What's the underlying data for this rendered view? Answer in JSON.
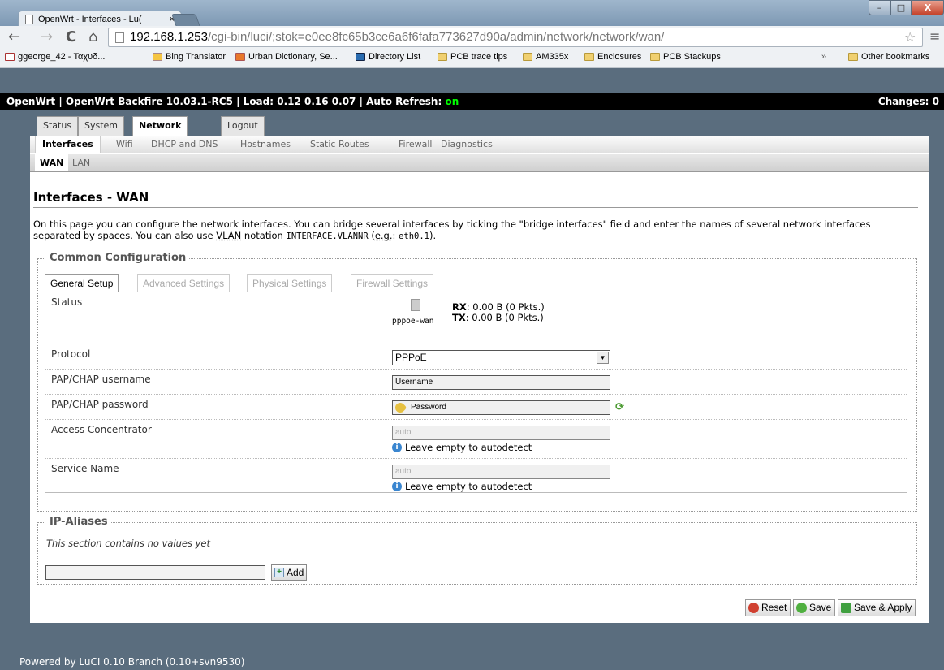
{
  "browser": {
    "tab_title": "OpenWrt - Interfaces - Lu(",
    "tab_close": "×",
    "url_host": "192.168.1.253",
    "url_path": "/cgi-bin/luci/;stok=e0ee8fc65b3ce6a6f6fafa773627d90a/admin/network/network/wan/",
    "back": "←",
    "forward": "→",
    "reload": "C",
    "home": "⌂",
    "star": "☆",
    "menu": "≡",
    "window_min": "–",
    "window_max": "□",
    "window_close": "X",
    "bookmarks": [
      {
        "label": "ggeorge_42 - Ταχυδ...",
        "icon": "mail-icon"
      },
      {
        "label": "Bing Translator",
        "icon": "bing-icon"
      },
      {
        "label": "Urban Dictionary, Se...",
        "icon": "ud-icon"
      },
      {
        "label": "Directory List",
        "icon": "directory-icon"
      },
      {
        "label": "PCB trace tips",
        "icon": "folder-icon"
      },
      {
        "label": "AM335x",
        "icon": "folder-icon"
      },
      {
        "label": "Enclosures",
        "icon": "folder-icon"
      },
      {
        "label": "PCB Stackups",
        "icon": "folder-icon"
      }
    ],
    "bookmarks_overflow": "»",
    "other_bookmarks": "Other bookmarks"
  },
  "header": {
    "info": "OpenWrt | OpenWrt Backfire 10.03.1-RC5 | Load: 0.12 0.16 0.07 | Auto Refresh: ",
    "auto_refresh": "on",
    "changes": "Changes: 0"
  },
  "menu": {
    "top": [
      "Status",
      "System",
      "Network",
      "Logout"
    ],
    "network": [
      "Interfaces",
      "Wifi",
      "DHCP and DNS",
      "Hostnames",
      "Static Routes",
      "Firewall",
      "Diagnostics"
    ],
    "interfaces": [
      "WAN",
      "LAN"
    ]
  },
  "page": {
    "title": "Interfaces - WAN",
    "desc_1": "On this page you can configure the network interfaces. You can bridge several interfaces by ticking the \"bridge interfaces\" field and enter the names of several network interfaces separated by spaces. You can also use ",
    "desc_vlan": "VLAN",
    "desc_2": " notation ",
    "desc_code1": "INTERFACE.VLANNR",
    "desc_3": " (",
    "desc_eg": "e.g.",
    "desc_4": ": ",
    "desc_code2": "eth0.1",
    "desc_5": ")."
  },
  "common": {
    "legend": "Common Configuration",
    "tabs": [
      "General Setup",
      "Advanced Settings",
      "Physical Settings",
      "Firewall Settings"
    ],
    "status_label": "Status",
    "iface_name": "pppoe-wan",
    "rx_label": "RX",
    "rx_value": ": 0.00 B (0 Pkts.)",
    "tx_label": "TX",
    "tx_value": ": 0.00 B (0 Pkts.)",
    "protocol_label": "Protocol",
    "protocol_value": "PPPoE",
    "username_label": "PAP/CHAP username",
    "username_value": "Username",
    "password_label": "PAP/CHAP password",
    "password_value": "Password",
    "ac_label": "Access Concentrator",
    "ac_placeholder": "auto",
    "ac_hint": "Leave empty to autodetect",
    "service_label": "Service Name",
    "service_placeholder": "auto",
    "service_hint": "Leave empty to autodetect"
  },
  "aliases": {
    "legend": "IP-Aliases",
    "empty": "This section contains no values yet",
    "add": "Add"
  },
  "actions": {
    "reset": "Reset",
    "save": "Save",
    "save_apply": "Save & Apply"
  },
  "footer": "Powered by LuCI 0.10 Branch (0.10+svn9530)",
  "colors": {
    "header_bg": "#000000",
    "auto_refresh_on": "#00ff00",
    "page_bg": "#5a6d7e"
  }
}
